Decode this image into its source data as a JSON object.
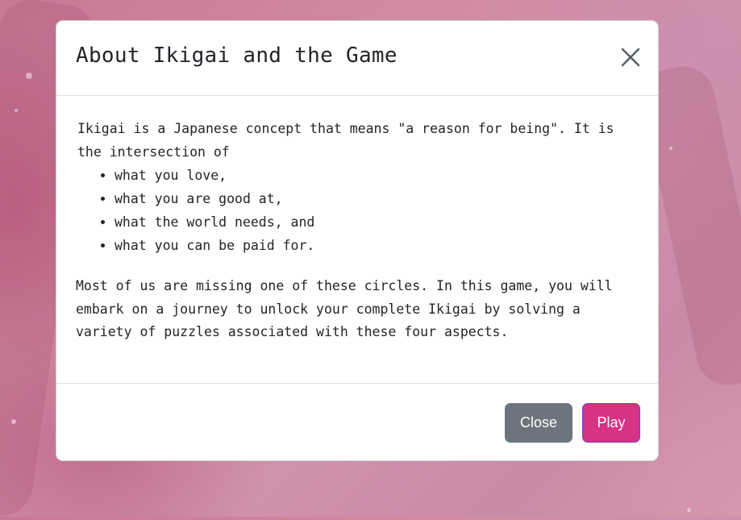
{
  "modal": {
    "title": "About Ikigai and the Game",
    "close_icon": "close-icon",
    "body": {
      "intro": "Ikigai is a Japanese concept that means \"a reason for being\". It is the intersection of",
      "aspects": [
        "what you love,",
        "what you are good at,",
        "what the world needs, and",
        "what you can be paid for."
      ],
      "paragraph": "Most of us are missing one of these circles. In this game, you will embark on a journey to unlock your complete Ikigai by solving a variety of puzzles associated with these four aspects."
    },
    "footer": {
      "close_label": "Close",
      "play_label": "Play"
    }
  },
  "colors": {
    "close_button": "#6c757d",
    "play_button": "#d63384",
    "play_border": "#6f42c1",
    "background": "#cf8aa6"
  }
}
